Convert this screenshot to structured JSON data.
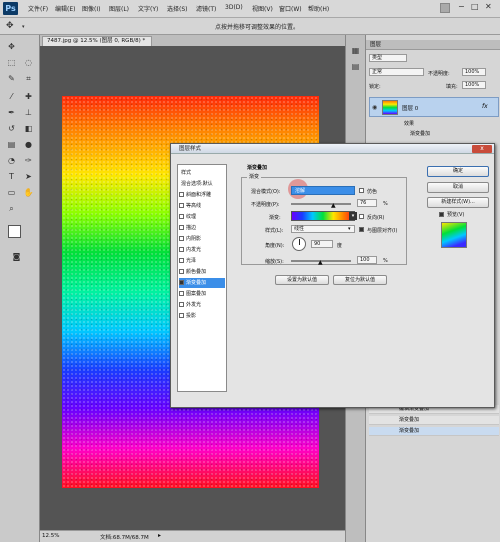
{
  "app": {
    "logo": "Ps",
    "menus": [
      "文件(F)",
      "编辑(E)",
      "图像(I)",
      "图层(L)",
      "文字(Y)",
      "选择(S)",
      "滤镜(T)",
      "3D(D)",
      "视图(V)",
      "窗口(W)",
      "帮助(H)"
    ],
    "hint": "点按并拖移可调整效果的位置。"
  },
  "document": {
    "tab_title": "7487.jpg @ 12.5% (图层 0, RGB/8) *",
    "zoom": "12.5%",
    "doc_size": "文档:68.7M/68.7M"
  },
  "layers_panel": {
    "title": "图层",
    "kind": "类型",
    "blend": "正常",
    "opacity_label": "不透明度:",
    "opacity": "100%",
    "lock_label": "锁定:",
    "fill_label": "填充:",
    "fill": "100%",
    "layer_name": "图层 0",
    "fx": "fx",
    "effects_label": "效果",
    "effect_item": "渐变叠加"
  },
  "history_panel": {
    "items": [
      "编辑渐变叠加",
      "渐变叠加",
      "渐变叠加"
    ]
  },
  "dialog": {
    "title": "图层样式",
    "close": "x",
    "style_list": [
      {
        "label": "样式",
        "checkbox": false,
        "checked": false,
        "selected": false
      },
      {
        "label": "混合选项:默认",
        "checkbox": false,
        "checked": false,
        "selected": false
      },
      {
        "label": "斜面和浮雕",
        "checkbox": true,
        "checked": false,
        "selected": false
      },
      {
        "label": "等高线",
        "checkbox": true,
        "checked": false,
        "selected": false
      },
      {
        "label": "纹理",
        "checkbox": true,
        "checked": false,
        "selected": false
      },
      {
        "label": "描边",
        "checkbox": true,
        "checked": false,
        "selected": false
      },
      {
        "label": "内阴影",
        "checkbox": true,
        "checked": false,
        "selected": false
      },
      {
        "label": "内发光",
        "checkbox": true,
        "checked": false,
        "selected": false
      },
      {
        "label": "光泽",
        "checkbox": true,
        "checked": false,
        "selected": false
      },
      {
        "label": "颜色叠加",
        "checkbox": true,
        "checked": false,
        "selected": false
      },
      {
        "label": "渐变叠加",
        "checkbox": true,
        "checked": true,
        "selected": true
      },
      {
        "label": "图案叠加",
        "checkbox": true,
        "checked": false,
        "selected": false
      },
      {
        "label": "外发光",
        "checkbox": true,
        "checked": false,
        "selected": false
      },
      {
        "label": "投影",
        "checkbox": true,
        "checked": false,
        "selected": false
      }
    ],
    "section_title": "渐变叠加",
    "group_title": "渐变",
    "blend_mode_label": "混合模式(O):",
    "blend_mode": "溶解",
    "dither_label": "仿色",
    "opacity_label": "不透明度(P):",
    "opacity_value": "76",
    "opacity_unit": "%",
    "gradient_label": "渐变:",
    "reverse_label": "反向(R)",
    "style_label": "样式(L):",
    "style_value": "线性",
    "align_label": "与图层对齐(I)",
    "angle_label": "角度(N):",
    "angle_value": "90",
    "angle_unit": "度",
    "scale_label": "缩放(S):",
    "scale_value": "100",
    "scale_unit": "%",
    "make_default": "设置为默认值",
    "reset_default": "复位为默认值",
    "ok": "确定",
    "cancel": "取消",
    "new_style": "新建样式(W)...",
    "preview_label": "预览(V)"
  },
  "colors": {
    "ps_blue": "#0c3a66",
    "selection_blue": "#3b8ee8",
    "blend_field": "#3b8ee8"
  }
}
